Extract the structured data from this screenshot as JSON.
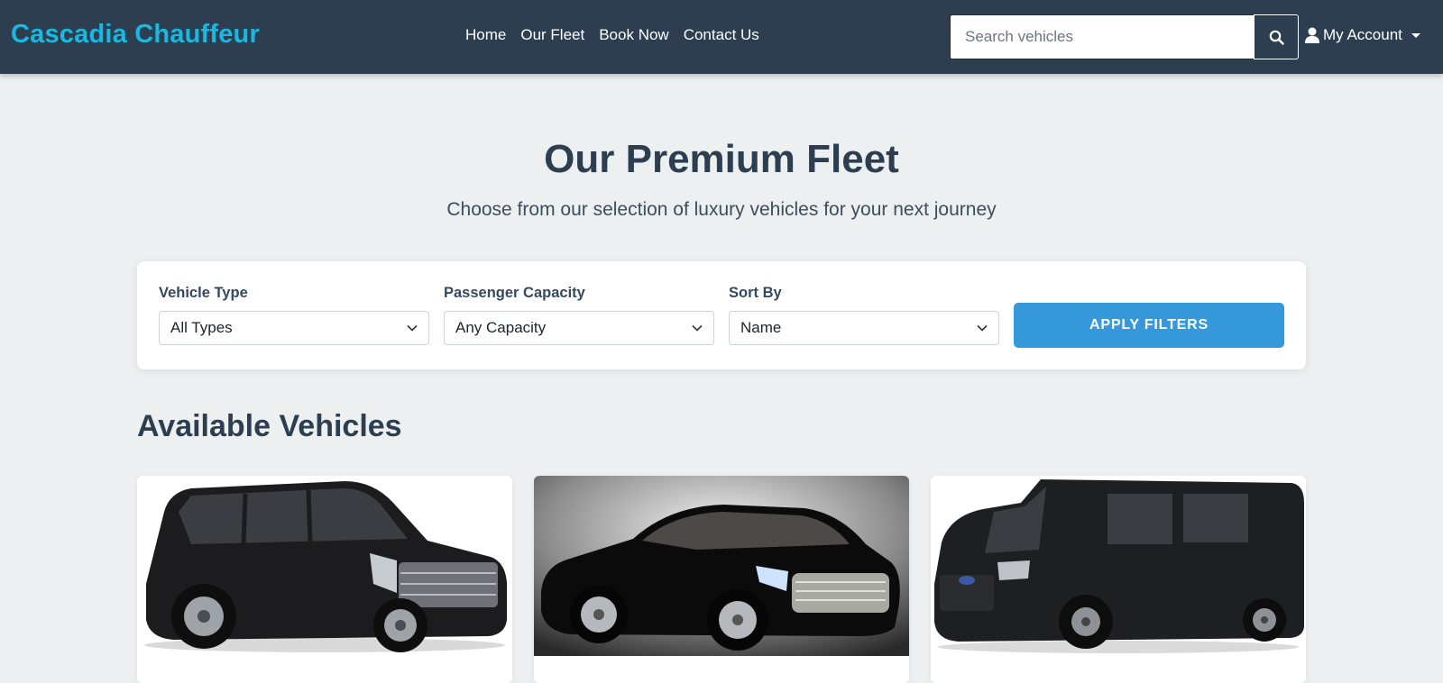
{
  "navbar": {
    "brand": "Cascadia Chauffeur",
    "links": [
      "Home",
      "Our Fleet",
      "Book Now",
      "Contact Us"
    ],
    "search_placeholder": "Search vehicles",
    "search_icon": "search-icon",
    "account_label": "My Account",
    "account_icon": "user-icon",
    "colors": {
      "background": "#2c3e50",
      "brand": "#1ab8e0"
    }
  },
  "hero": {
    "title": "Our Premium Fleet",
    "subtitle": "Choose from our selection of luxury vehicles for your next journey"
  },
  "filters": {
    "vehicle_type": {
      "label": "Vehicle Type",
      "value": "All Types"
    },
    "capacity": {
      "label": "Passenger Capacity",
      "value": "Any Capacity"
    },
    "sort": {
      "label": "Sort By",
      "value": "Name"
    },
    "apply_label": "APPLY FILTERS",
    "apply_color": "#3498db"
  },
  "vehicles": {
    "title": "Available Vehicles",
    "cards": [
      {
        "image": "black-suv-image"
      },
      {
        "image": "black-sedan-image"
      },
      {
        "image": "black-van-image"
      }
    ]
  }
}
